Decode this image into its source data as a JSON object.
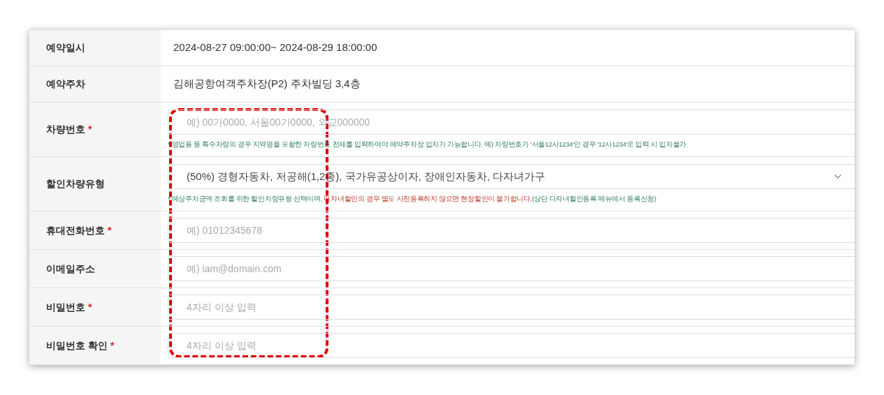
{
  "rows": [
    {
      "label": "예약일시",
      "kind": "static",
      "value": "2024-08-27 09:00:00~ 2024-08-29 18:00:00"
    },
    {
      "label": "예약주차",
      "kind": "static",
      "value": "김해공항여객주차장(P2) 주차빌딩 3,4층"
    },
    {
      "label": "차량번호",
      "required_mark": "*",
      "kind": "input",
      "placeholder": "예) 00가0000, 서울00가0000, 외교000000",
      "note": [
        {
          "text": "* 영업용 등 특수차량의 경우 지역명을 포함한 차량번호 전체를 입력하여야 예약주차장 입차가 가능합니다. 예) 차량번호가 '서울12사1234'인 경우 '12사1234'로 입력 시 입차불가",
          "kind": "info"
        }
      ]
    },
    {
      "label": "할인차량유형",
      "kind": "select",
      "value": "(50%) 경형자동차, 저공해(1,2종), 국가유공상이자, 장애인자동차, 다자녀가구",
      "note": [
        {
          "text": "* 예상주차금액 조회를 위한 할인차량유형 선택이며, ",
          "kind": "info"
        },
        {
          "text": "다자녀할인의 경우 별도 사전등록하지 않으면 현장할인이 불가합니다.",
          "kind": "warning"
        },
        {
          "text": "(상단 다자녀할인등록 메뉴에서 등록신청)",
          "kind": "info"
        }
      ]
    },
    {
      "label": "휴대전화번호",
      "required_mark": "*",
      "kind": "input",
      "placeholder": "예) 01012345678"
    },
    {
      "label": "이메일주소",
      "kind": "input",
      "placeholder": "예) iam@domain.com"
    },
    {
      "label": "비밀번호",
      "required_mark": "*",
      "kind": "input",
      "placeholder": "4자리 이상 입력"
    },
    {
      "label": "비밀번호 확인",
      "required_mark": "*",
      "kind": "input",
      "placeholder": "4자리 이상 입력"
    }
  ]
}
